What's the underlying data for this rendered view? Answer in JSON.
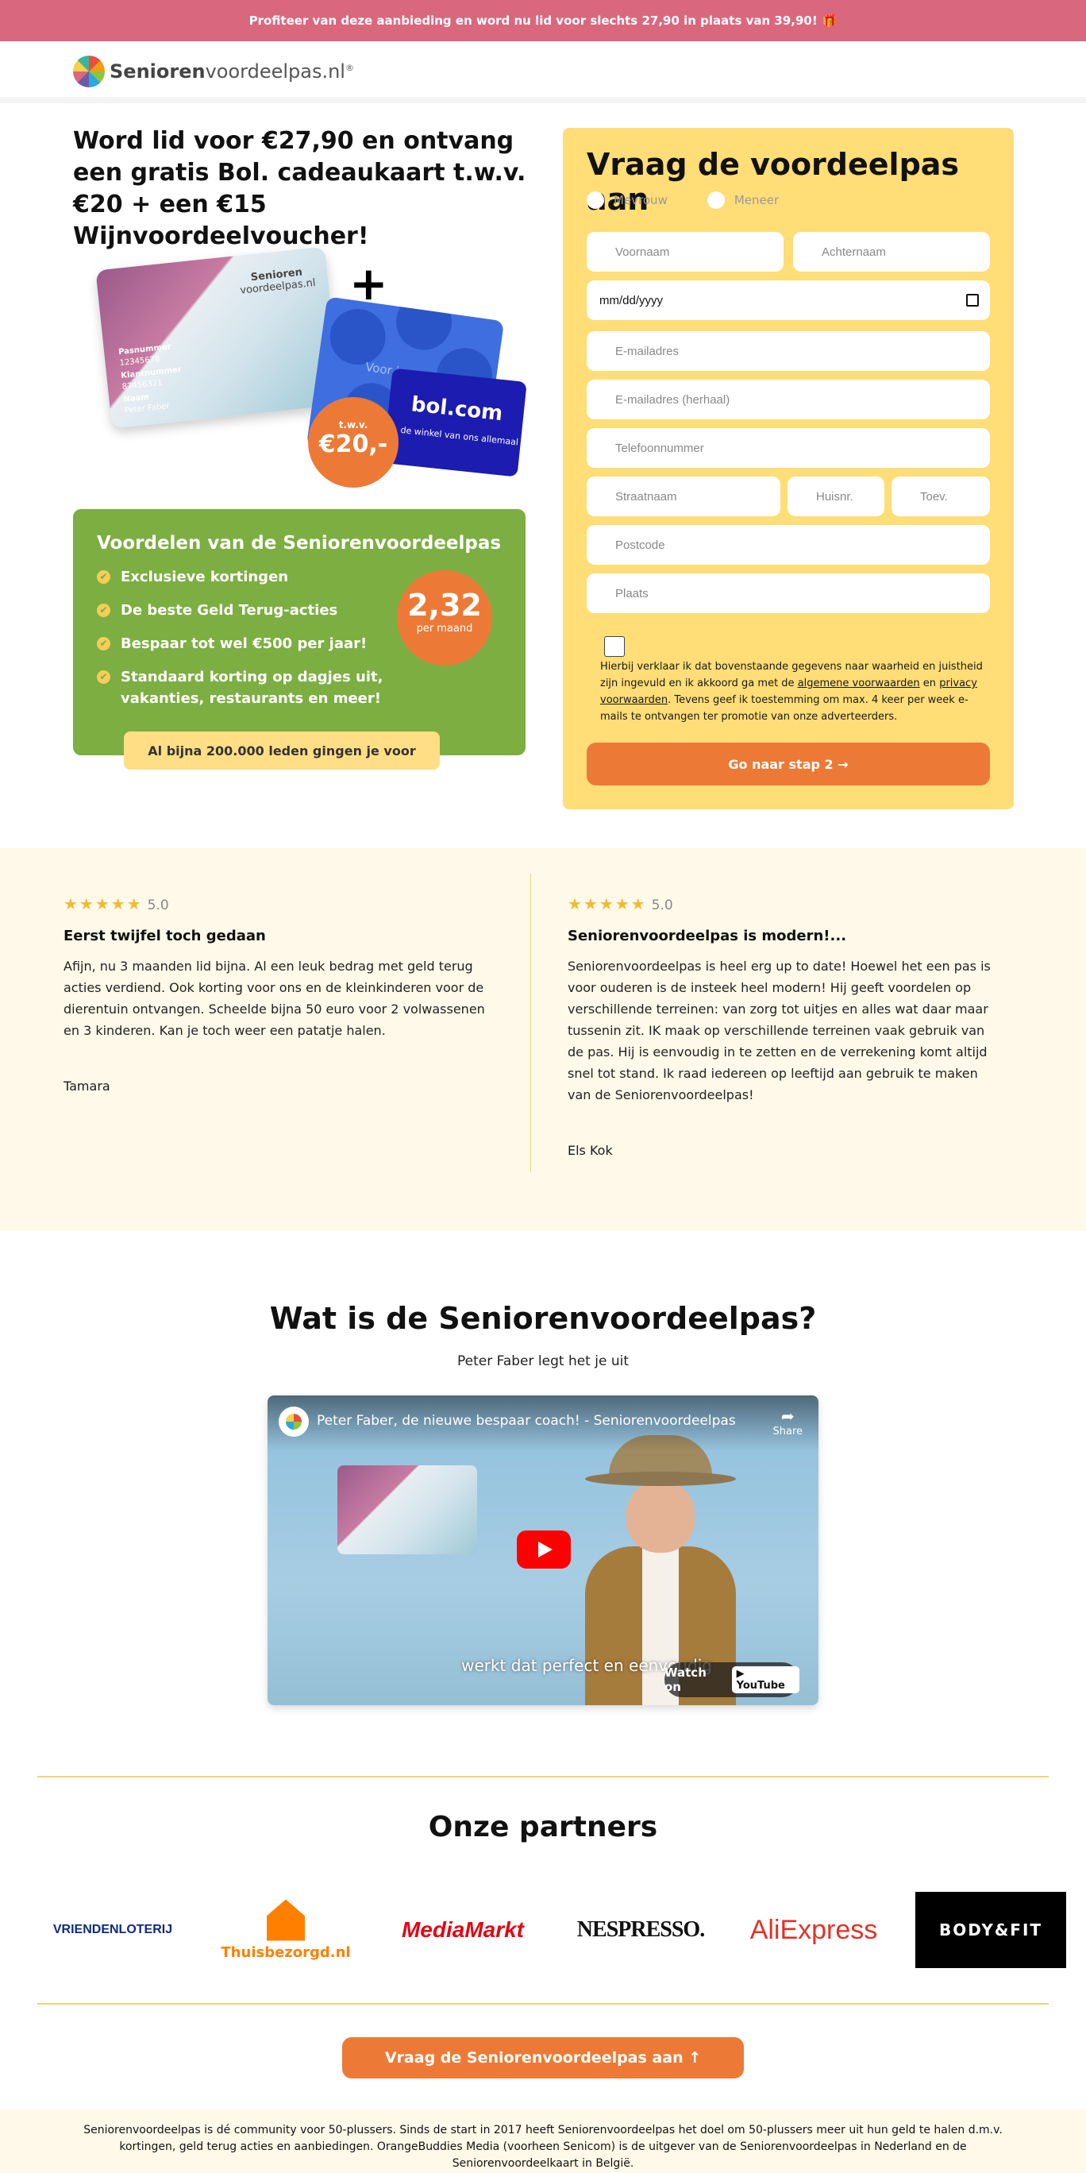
{
  "promo": {
    "text": "Profiteer van deze aanbieding en word nu lid voor slechts 27,90 in plaats van 39,90!",
    "icon": "gift-icon"
  },
  "header": {
    "logo_bold": "Senioren",
    "logo_rest": "voordeelpas.nl",
    "logo_reg": "®"
  },
  "hero": {
    "title": "Word lid voor €27,90 en ontvang een gratis Bol. cadeaukaart t.w.v. €20 + een €15 Wijnvoordeelvoucher!",
    "card": {
      "logo_line1": "Senioren",
      "logo_line2": "voordeelpas.nl",
      "pasnummer_label": "Pasnummer",
      "pasnummer_value": "12345678",
      "klantnummer_label": "Klantnummer",
      "klantnummer_value": "87456321",
      "naam_label": "Naam",
      "naam_value": "Peter Faber"
    },
    "plus": "+",
    "gift_card_voor": "Voor jou",
    "bol_name": "bol.com",
    "bol_tagline": "de winkel van ons allemaal",
    "price_small": "t.w.v.",
    "price_big": "€20,-"
  },
  "benefits": {
    "title": "Voordelen van de Seniorenvoordeelpas",
    "items": [
      "Exclusieve kortingen",
      "De beste Geld Terug-acties",
      "Bespaar tot wel €500 per jaar!",
      "Standaard korting op dagjes uit, vakanties, restaurants en meer!"
    ],
    "badge_price": "2,32",
    "badge_unit": "per maand",
    "members_text": "Al bijna 200.000 leden gingen je voor"
  },
  "form": {
    "title": "Vraag de voordeelpas aan",
    "radio_options": [
      "Mevrouw",
      "Meneer"
    ],
    "fields": {
      "voornaam": "Voornaam",
      "achternaam": "Achternaam",
      "date": "mm/dd/yyyy",
      "email": "E-mailadres",
      "email_repeat": "E-mailadres (herhaal)",
      "phone": "Telefoonnummer",
      "street": "Straatnaam",
      "house": "Huisnr.",
      "addition": "Toev.",
      "postcode": "Postcode",
      "city": "Plaats"
    },
    "consent_part1": "Hierbij verklaar ik dat bovenstaande gegevens naar waarheid en juistheid zijn ingevuld en ik akkoord ga met de ",
    "consent_link1": "algemene voorwaarden",
    "consent_part2": " en ",
    "consent_link2": "privacy voorwaarden",
    "consent_part3": ". Tevens geef ik toestemming om max. 4 keer per week e-mails te ontvangen ter promotie van onze adverteerders.",
    "submit": "Go naar stap 2 →"
  },
  "reviews": [
    {
      "stars": "★★★★★",
      "score": "5.0",
      "title": "Eerst twijfel toch gedaan",
      "body": "Afijn, nu 3 maanden lid bijna. Al een leuk bedrag met geld terug acties verdiend. Ook korting voor ons en de kleinkinderen voor de dierentuin ontvangen. Scheelde bijna 50 euro voor 2 volwassenen en 3 kinderen. Kan je toch weer een patatje halen.",
      "author": "Tamara"
    },
    {
      "stars": "★★★★★",
      "score": "5.0",
      "title": "Seniorenvoordeelpas is modern!...",
      "body": "Seniorenvoordeelpas is heel erg up to date! Hoewel het een pas is voor ouderen is de insteek heel modern! Hij geeft voordelen op verschillende terreinen: van zorg tot uitjes en alles wat daar maar tussenin zit. IK maak op verschillende terreinen vaak gebruik van de pas. Hij is eenvoudig in te zetten en de verrekening komt altijd snel tot stand. Ik raad iedereen op leeftijd aan gebruik te maken van de Seniorenvoordeelpas!",
      "author": "Els Kok"
    }
  ],
  "video": {
    "section_title": "Wat is de Seniorenvoordeelpas?",
    "subtitle": "Peter Faber legt het je uit",
    "title": "Peter Faber, de nieuwe bespaar coach! - Seniorenvoordeelpas",
    "share": "Share",
    "caption": "werkt dat perfect en eenvoudig",
    "watch_on": "Watch on",
    "youtube": "YouTube"
  },
  "partners": {
    "title": "Onze partners",
    "items": [
      "VRIENDENLOTERIJ",
      "Thuisbezorgd.nl",
      "MediaMarkt",
      "NESPRESSO.",
      "AliExpress",
      "BODY&FIT"
    ]
  },
  "cta": {
    "label": "Vraag de Seniorenvoordeelpas aan ↑"
  },
  "footer": {
    "text": "Seniorenvoordeelpas is dé community voor 50-plussers. Sinds de start in 2017 heeft Seniorenvoordeelpas het doel om 50-plussers meer uit hun geld te halen d.m.v. kortingen, geld terug acties en aanbiedingen. OrangeBuddies Media (voorheen Senicom) is de uitgever van de Seniorenvoordeelpas in Nederland en de Seniorenvoordeelkaart in België."
  },
  "colors": {
    "promo": "#d9687f",
    "accent_orange": "#ec7a36",
    "green": "#7cae41",
    "form_yellow": "#ffdd77",
    "review_bg": "#fef9e8"
  }
}
